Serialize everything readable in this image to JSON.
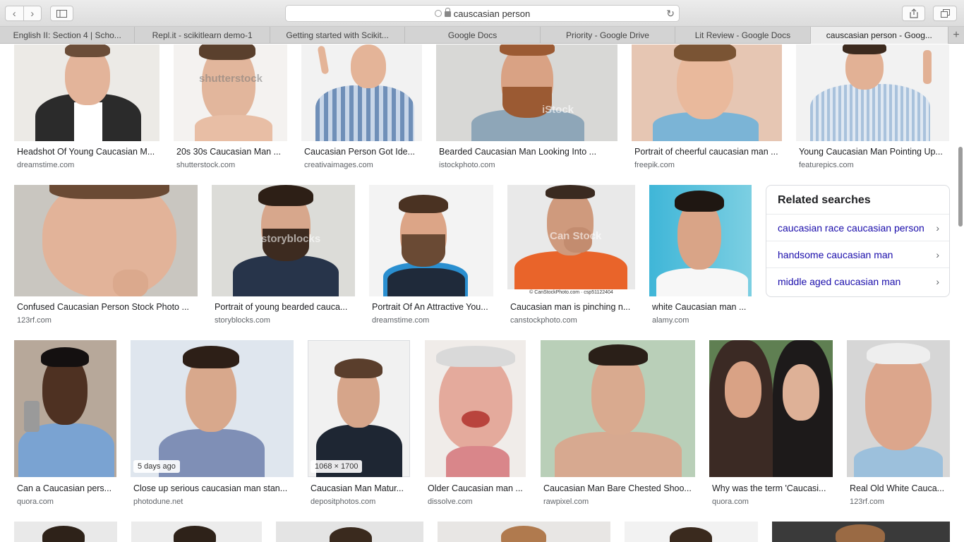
{
  "toolbar": {
    "address": "causcasian person"
  },
  "tabs": [
    {
      "label": "English II: Section 4 | Scho..."
    },
    {
      "label": "Repl.it - scikitlearn demo-1"
    },
    {
      "label": "Getting started with Scikit..."
    },
    {
      "label": "Google Docs"
    },
    {
      "label": "Priority - Google Drive"
    },
    {
      "label": "Lit Review - Google Docs"
    },
    {
      "label": "causcasian person - Goog..."
    }
  ],
  "results": {
    "row1": [
      {
        "title": "Headshot Of Young Caucasian M...",
        "source": "dreamstime.com",
        "watermark": ""
      },
      {
        "title": "20s 30s Caucasian Man ...",
        "source": "shutterstock.com",
        "watermark": "shutterstock"
      },
      {
        "title": "Caucasian Person Got Ide...",
        "source": "creativaimages.com",
        "watermark": ""
      },
      {
        "title": "Bearded Caucasian Man Looking Into ...",
        "source": "istockphoto.com",
        "watermark": "iStock"
      },
      {
        "title": "Portrait of cheerful caucasian man ...",
        "source": "freepik.com",
        "watermark": ""
      },
      {
        "title": "Young Caucasian Man Pointing Up...",
        "source": "featurepics.com",
        "watermark": ""
      }
    ],
    "row2": [
      {
        "title": "Confused Caucasian Person Stock Photo ...",
        "source": "123rf.com",
        "watermark": ""
      },
      {
        "title": "Portrait of young bearded cauca...",
        "source": "storyblocks.com",
        "watermark": "storyblocks"
      },
      {
        "title": "Portrait Of An Attractive You...",
        "source": "dreamstime.com",
        "watermark": ""
      },
      {
        "title": "Caucasian man is pinching n...",
        "source": "canstockphoto.com",
        "watermark": "Can Stock"
      },
      {
        "title": "white Caucasian man ...",
        "source": "alamy.com",
        "watermark": ""
      }
    ],
    "row3": [
      {
        "title": "Can a Caucasian pers...",
        "source": "quora.com",
        "badge": ""
      },
      {
        "title": "Close up serious caucasian man stan...",
        "source": "photodune.net",
        "badge": "5 days ago"
      },
      {
        "title": "Caucasian Man Matur...",
        "source": "depositphotos.com",
        "badge": "1068 × 1700"
      },
      {
        "title": "Older Caucasian man ...",
        "source": "dissolve.com",
        "badge": ""
      },
      {
        "title": "Caucasian Man Bare Chested Shoo...",
        "source": "rawpixel.com",
        "badge": ""
      },
      {
        "title": "Why was the term 'Caucasi...",
        "source": "quora.com",
        "badge": ""
      },
      {
        "title": "Real Old White Cauca...",
        "source": "123rf.com",
        "badge": ""
      }
    ]
  },
  "related": {
    "heading": "Related searches",
    "items": [
      {
        "label": "caucasian race caucasian person"
      },
      {
        "label": "handsome caucasian man"
      },
      {
        "label": "middle aged caucasian man"
      }
    ]
  },
  "image_overlays": {
    "canstock_caption": "© CanStockPhoto.com · csp51122404"
  },
  "icons": {
    "back": "chevron-left-icon",
    "forward": "chevron-right-icon",
    "sidebar": "sidebar-icon",
    "search": "search-icon",
    "lock": "lock-icon",
    "reload": "reload-icon",
    "share": "share-icon",
    "tabs": "tabs-overview-icon",
    "new_tab": "plus-icon",
    "chevron": "chevron-right-icon"
  },
  "colors": {
    "link": "#1a0dab",
    "source": "#5f6368",
    "title": "#202124"
  }
}
